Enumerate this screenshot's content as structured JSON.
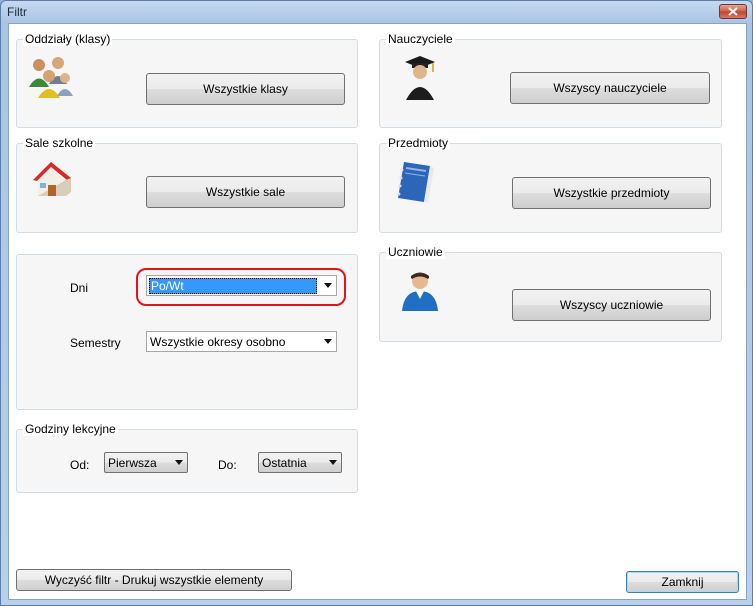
{
  "window": {
    "title": "Filtr"
  },
  "groups": {
    "classes": {
      "title": "Oddziały (klasy)",
      "button": "Wszystkie klasy"
    },
    "teachers": {
      "title": "Nauczyciele",
      "button": "Wszyscy nauczyciele"
    },
    "rooms": {
      "title": "Sale szkolne",
      "button": "Wszystkie sale"
    },
    "subjects": {
      "title": "Przedmioty",
      "button": "Wszystkie przedmioty"
    },
    "students": {
      "title": "Uczniowie",
      "button": "Wszyscy uczniowie"
    },
    "days": {
      "days_label": "Dni",
      "days_value": "Po/Wt",
      "semester_label": "Semestry",
      "semester_value": "Wszystkie okresy osobno"
    },
    "hours": {
      "title": "Godziny lekcyjne",
      "from_label": "Od:",
      "from_value": "Pierwsza",
      "to_label": "Do:",
      "to_value": "Ostatnia"
    }
  },
  "footer": {
    "clear_button": "Wyczyść filtr - Drukuj wszystkie elementy",
    "close_button": "Zamknij"
  },
  "colors": {
    "accent": "#3399ff",
    "highlight": "#e2141b"
  }
}
